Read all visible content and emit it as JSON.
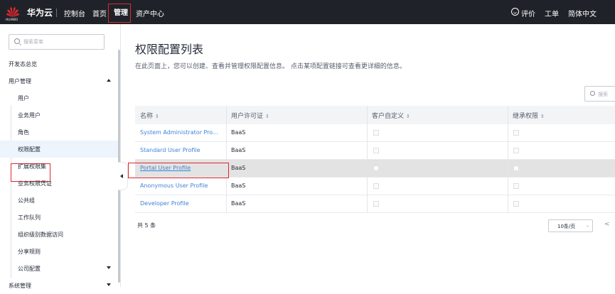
{
  "topbar": {
    "logo_text": "HUAWEI",
    "brand": "华为云",
    "nav": [
      "控制台",
      "首页",
      "管理",
      "资产中心"
    ],
    "right": {
      "feedback": "评价",
      "ticket": "工单",
      "language": "简体中文"
    }
  },
  "sidebar": {
    "search_placeholder": "搜索菜单",
    "items": [
      {
        "label": "开发态总览",
        "level": "top"
      },
      {
        "label": "用户管理",
        "level": "top",
        "expanded": true
      },
      {
        "label": "用户",
        "level": "sub"
      },
      {
        "label": "业务用户",
        "level": "sub"
      },
      {
        "label": "角色",
        "level": "sub"
      },
      {
        "label": "权限配置",
        "level": "sub",
        "active": true
      },
      {
        "label": "扩展权限集",
        "level": "sub"
      },
      {
        "label": "业务权限凭证",
        "level": "sub"
      },
      {
        "label": "公共组",
        "level": "sub"
      },
      {
        "label": "工作队列",
        "level": "sub"
      },
      {
        "label": "组织级别数据访问",
        "level": "sub"
      },
      {
        "label": "分享规则",
        "level": "sub"
      },
      {
        "label": "公司配置",
        "level": "sub",
        "collapsed": true
      },
      {
        "label": "系统管理",
        "level": "top",
        "collapsed": true
      }
    ]
  },
  "main": {
    "title": "权限配置列表",
    "description": "在此页面上，您可以创建、查看并管理权限配置信息。 点击某项配置链接可查看更详细的信息。",
    "search_placeholder": "搜索",
    "columns": [
      "名称",
      "用户许可证",
      "客户自定义",
      "继承权限"
    ],
    "sort_glyph": "⇕",
    "rows": [
      {
        "name": "System Administrator Pro...",
        "license": "BaaS"
      },
      {
        "name": "Standard User Profile",
        "license": "BaaS"
      },
      {
        "name": "Portal User Profile",
        "license": "BaaS"
      },
      {
        "name": "Anonymous User Profile",
        "license": "BaaS"
      },
      {
        "name": "Developer Profile",
        "license": "BaaS"
      }
    ],
    "total": "共 5 条",
    "page_size": "10条/页"
  },
  "colors": {
    "topbar_bg": "#1f2329",
    "link": "#3f84d6",
    "highlight_box": "#e0262e",
    "active_item_bg": "#eef4fc"
  }
}
